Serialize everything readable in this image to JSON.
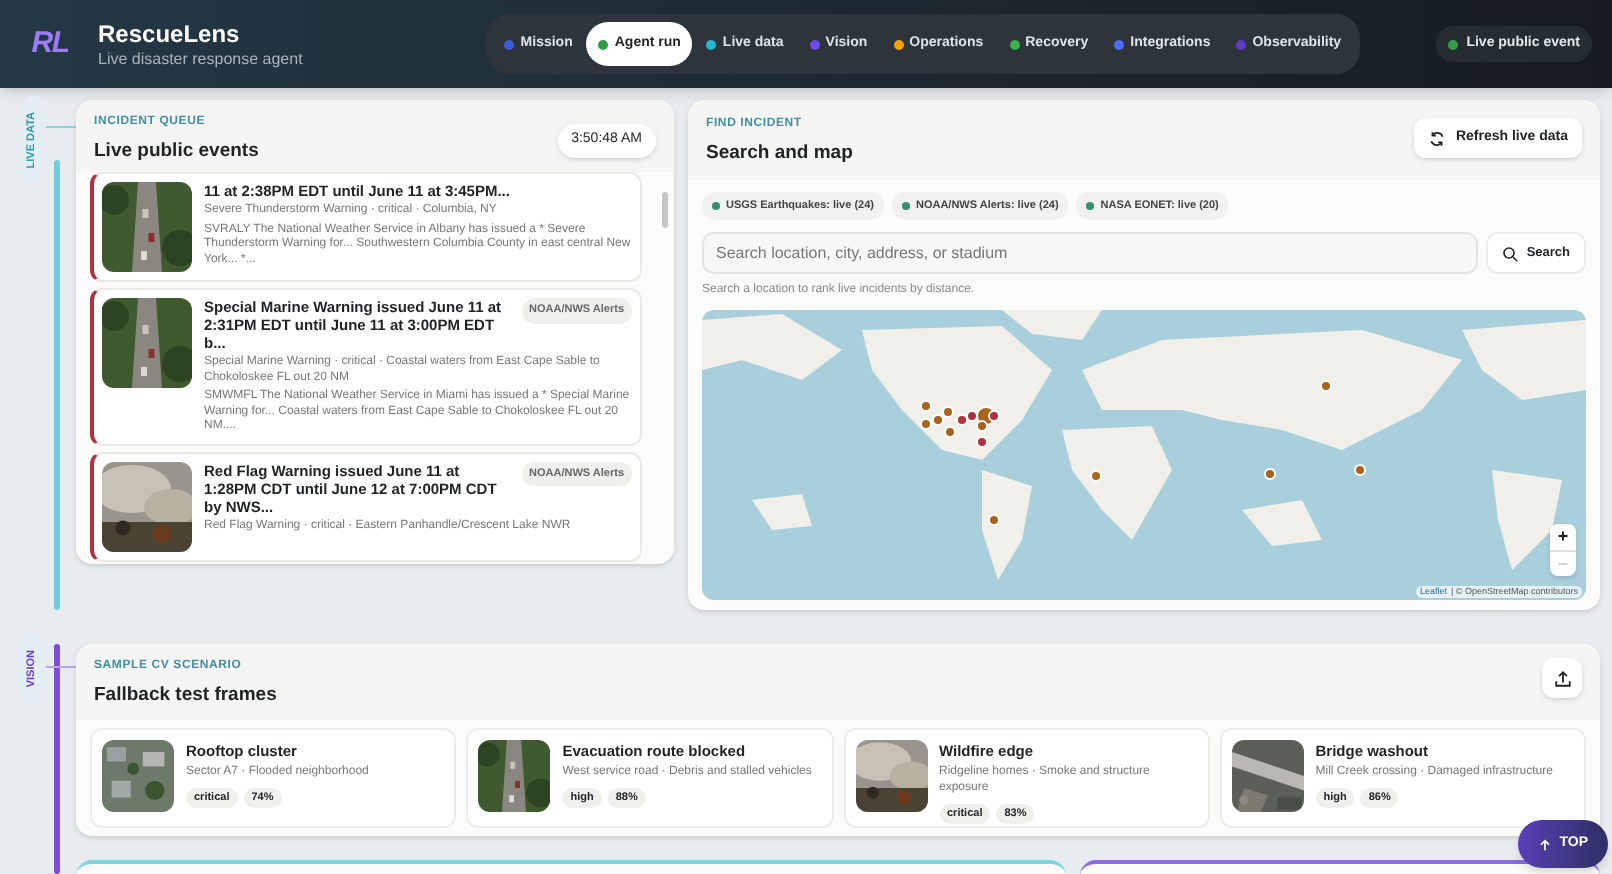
{
  "app": {
    "logo_text": "RL",
    "title": "RescueLens",
    "subtitle": "Live disaster response agent"
  },
  "nav": [
    {
      "label": "Mission",
      "selected": false,
      "color": "#3b5bdb"
    },
    {
      "label": "Agent run",
      "selected": true,
      "color": "#2f9e44"
    },
    {
      "label": "Live data",
      "selected": false,
      "color": "#22b8cf"
    },
    {
      "label": "Vision",
      "selected": false,
      "color": "#7048e8"
    },
    {
      "label": "Operations",
      "selected": false,
      "color": "#f59f00"
    },
    {
      "label": "Recovery",
      "selected": false,
      "color": "#37b24d"
    },
    {
      "label": "Integrations",
      "selected": false,
      "color": "#4c6ef5"
    },
    {
      "label": "Observability",
      "selected": false,
      "color": "#5f3dc4"
    }
  ],
  "live_badge": {
    "label": "Live public event",
    "color": "#2f9e44"
  },
  "rail": [
    {
      "label": "LIVE DATA"
    },
    {
      "label": "VISION"
    }
  ],
  "incident_queue": {
    "eyebrow": "INCIDENT QUEUE",
    "title": "Live public events",
    "time": "3:50:48 AM",
    "events": [
      {
        "title": "11 at 2:38PM EDT until June 11 at 3:45PM...",
        "meta": "Severe Thunderstorm Warning · critical · Columbia, NY",
        "description": "SVRALY The National Weather Service in Albany has issued a * Severe Thunderstorm Warning for... Southwestern Columbia County in east central New York... *..."
      },
      {
        "title": "Special Marine Warning issued June 11 at 2:31PM EDT until June 11 at 3:00PM EDT b...",
        "source": "NOAA/NWS Alerts",
        "meta": "Special Marine Warning · critical · Coastal waters from East Cape Sable to Chokoloskee FL out 20 NM",
        "description": "SMWMFL The National Weather Service in Miami has issued a * Special Marine Warning for... Coastal waters from East Cape Sable to Chokoloskee FL out 20 NM...."
      },
      {
        "title": "Red Flag Warning issued June 11 at 1:28PM CDT until June 12 at 7:00PM CDT by NWS...",
        "source": "NOAA/NWS Alerts",
        "meta": "Red Flag Warning · critical · Eastern Panhandle/Crescent Lake NWR"
      }
    ]
  },
  "find_incident": {
    "eyebrow": "FIND INCIDENT",
    "title": "Search and map",
    "refresh_button": "Refresh live data",
    "feeds": [
      {
        "label": "USGS Earthquakes: live (24)"
      },
      {
        "label": "NOAA/NWS Alerts: live (24)"
      },
      {
        "label": "NASA EONET: live (20)"
      }
    ],
    "search": {
      "placeholder": "Search location, city, address, or stadium",
      "button": "Search",
      "hint": "Search a location to rank live incidents by distance."
    },
    "map": {
      "zoom_in": "+",
      "zoom_out": "−",
      "attribution_link": "Leaflet",
      "attribution": "| © OpenStreetMap contributors",
      "markers": [
        {
          "color": "#a8641c"
        },
        {
          "color": "#a8641c"
        },
        {
          "color": "#a8641c"
        },
        {
          "color": "#a8641c"
        },
        {
          "color": "#a8641c"
        },
        {
          "color": "#b0303e"
        },
        {
          "color": "#b0303e"
        },
        {
          "color": "#a8641c"
        },
        {
          "color": "#a8641c"
        },
        {
          "color": "#b0303e"
        },
        {
          "color": "#b0303e"
        },
        {
          "color": "#a8641c"
        },
        {
          "color": "#a8641c"
        },
        {
          "color": "#a8641c"
        },
        {
          "color": "#a8641c"
        },
        {
          "color": "#a8641c"
        }
      ]
    }
  },
  "vision": {
    "eyebrow": "SAMPLE CV SCENARIO",
    "title": "Fallback test frames",
    "frames": [
      {
        "title": "Rooftop cluster",
        "description": "Sector A7 · Flooded neighborhood",
        "severity": "critical",
        "confidence": "74%"
      },
      {
        "title": "Evacuation route blocked",
        "description": "West service road · Debris and stalled vehicles",
        "severity": "high",
        "confidence": "88%"
      },
      {
        "title": "Wildfire edge",
        "description": "Ridgeline homes · Smoke and structure exposure",
        "severity": "critical",
        "confidence": "83%"
      },
      {
        "title": "Bridge washout",
        "description": "Mill Creek crossing · Damaged infrastructure",
        "severity": "high",
        "confidence": "86%"
      }
    ]
  },
  "top_button": "TOP"
}
